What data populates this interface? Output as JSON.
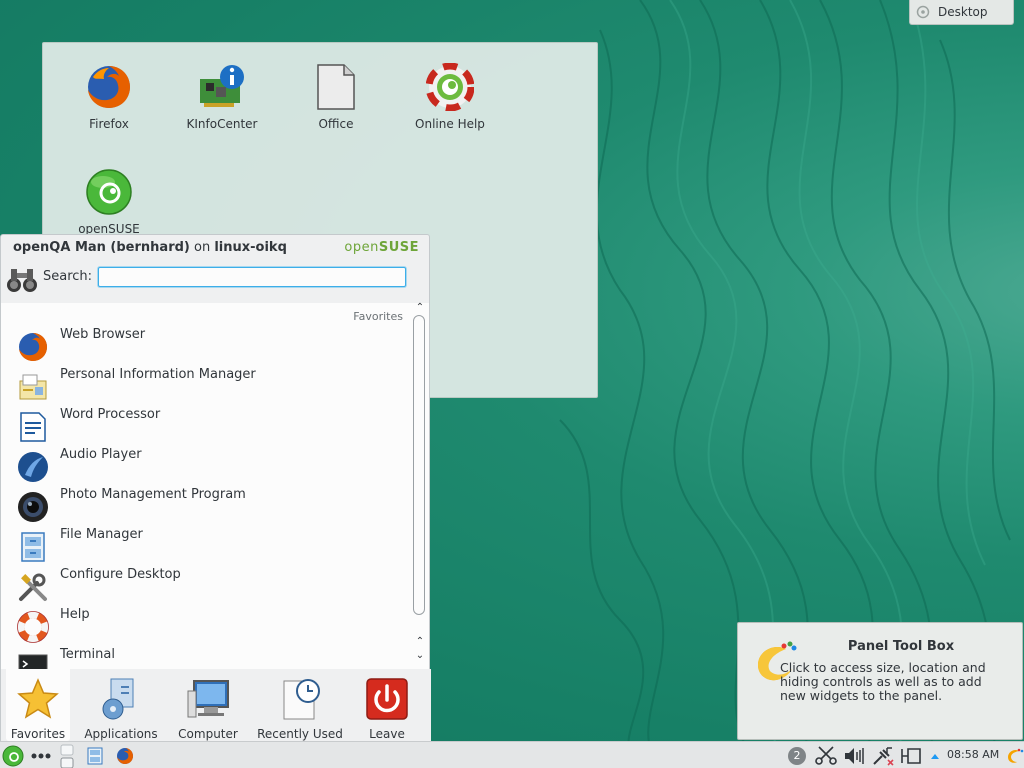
{
  "desktop": {
    "toolbox_label": "Desktop",
    "icons": [
      {
        "label": "Firefox",
        "icon": "firefox-icon"
      },
      {
        "label": "KInfoCenter",
        "icon": "kinfocenter-icon"
      },
      {
        "label": "Office",
        "icon": "office-icon"
      },
      {
        "label": "Online Help",
        "icon": "online-help-icon"
      },
      {
        "label": "openSUSE",
        "icon": "opensuse-icon"
      }
    ]
  },
  "kickoff": {
    "user_name": "openQA Man (bernhard)",
    "on_text": "on",
    "host": "linux-oikq",
    "brand_open": "open",
    "brand_suse": "SUSE",
    "search_label": "Search:",
    "search_value": "",
    "section_heading": "Favorites",
    "favorites": [
      {
        "label": "Web Browser",
        "icon": "firefox-icon"
      },
      {
        "label": "Personal Information Manager",
        "icon": "pim-icon"
      },
      {
        "label": "Word Processor",
        "icon": "word-processor-icon"
      },
      {
        "label": "Audio Player",
        "icon": "audio-player-icon"
      },
      {
        "label": "Photo Management Program",
        "icon": "camera-icon"
      },
      {
        "label": "File Manager",
        "icon": "file-manager-icon"
      },
      {
        "label": "Configure Desktop",
        "icon": "configure-icon"
      },
      {
        "label": "Help",
        "icon": "help-lifebuoy-icon"
      },
      {
        "label": "Terminal",
        "icon": "terminal-icon"
      }
    ],
    "tabs": [
      {
        "label": "Favorites",
        "icon": "star-icon",
        "active": true
      },
      {
        "label": "Applications",
        "icon": "applications-icon",
        "active": false
      },
      {
        "label": "Computer",
        "icon": "computer-icon",
        "active": false
      },
      {
        "label": "Recently Used",
        "icon": "recent-icon",
        "active": false
      },
      {
        "label": "Leave",
        "icon": "power-icon",
        "active": false
      }
    ]
  },
  "panel": {
    "pager_badge": "2",
    "clock": "08:58 AM"
  },
  "tooltip": {
    "title": "Panel Tool Box",
    "text": "Click to access size, location and hiding controls as well as to add new widgets to the panel."
  },
  "colors": {
    "accent": "#3daee9",
    "suse_green": "#6ea539",
    "wallpaper": "#1f8a6e",
    "leave_red": "#d52b1e"
  }
}
